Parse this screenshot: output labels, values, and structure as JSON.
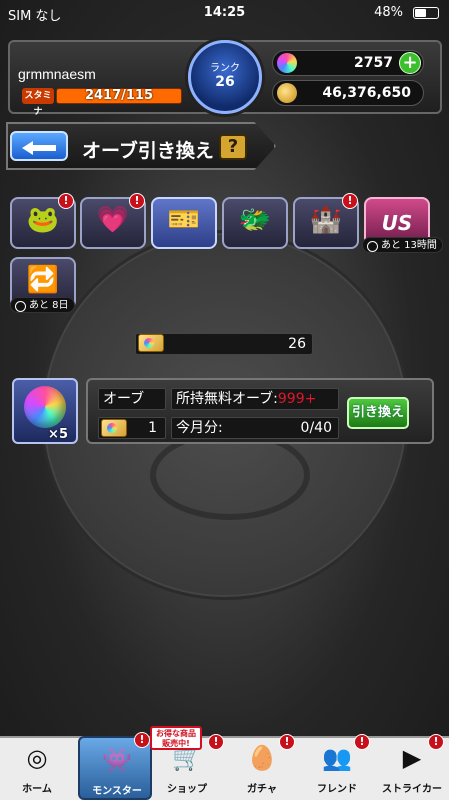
{
  "status_bar": {
    "carrier": "SIM なし",
    "time": "14:25",
    "battery": "48%"
  },
  "player": {
    "name": "grmmnaesm",
    "stamina_label": "スタミナ",
    "stamina": "2417/115",
    "rank_label": "ランク",
    "rank": "26",
    "orbs": "2757",
    "gold": "46,376,650"
  },
  "title": {
    "text": "オーブ引き換え",
    "help_label": "?"
  },
  "tiles": [
    {
      "icon": "frog-clover-icon",
      "glyph": "🐸",
      "badge": "!"
    },
    {
      "icon": "heart-card-icon",
      "glyph": "💗",
      "badge": "!"
    },
    {
      "icon": "orb-ticket-icon",
      "glyph": "🎫",
      "badge": ""
    },
    {
      "icon": "dragon-mascot-icon",
      "glyph": "🐲",
      "badge": ""
    },
    {
      "icon": "castle-icon",
      "glyph": "🏰",
      "badge": "!"
    },
    {
      "icon": "us-logo-icon",
      "glyph": "US",
      "badge": "",
      "timer": "あと 13時間"
    },
    {
      "icon": "exchange-card-icon",
      "glyph": "🔁",
      "badge": "",
      "timer": "あと 8日"
    }
  ],
  "ticket_count": "26",
  "exchange": {
    "multiplier": "×5",
    "orb_label": "オーブ",
    "ticket_cost": "1",
    "free_orbs_label": "所持無料オーブ:",
    "free_orbs_value": "999+",
    "monthly_label": "今月分:",
    "monthly_value": "0/40",
    "button_label": "引き換え"
  },
  "nav": {
    "sale_tag": "お得な商品 販売中!",
    "items": [
      {
        "label": "ホーム",
        "icon": "home-icon",
        "glyph": "◎",
        "badge": ""
      },
      {
        "label": "モンスター",
        "icon": "monster-icon",
        "glyph": "👾",
        "badge": "!"
      },
      {
        "label": "ショップ",
        "icon": "shop-cart-icon",
        "glyph": "🛒",
        "badge": "!"
      },
      {
        "label": "ガチャ",
        "icon": "gacha-egg-icon",
        "glyph": "🥚",
        "badge": "!"
      },
      {
        "label": "フレンド",
        "icon": "friend-icon",
        "glyph": "👥",
        "badge": "!"
      },
      {
        "label": "ストライカー",
        "icon": "striker-icon",
        "glyph": "▶",
        "badge": "!"
      }
    ]
  }
}
